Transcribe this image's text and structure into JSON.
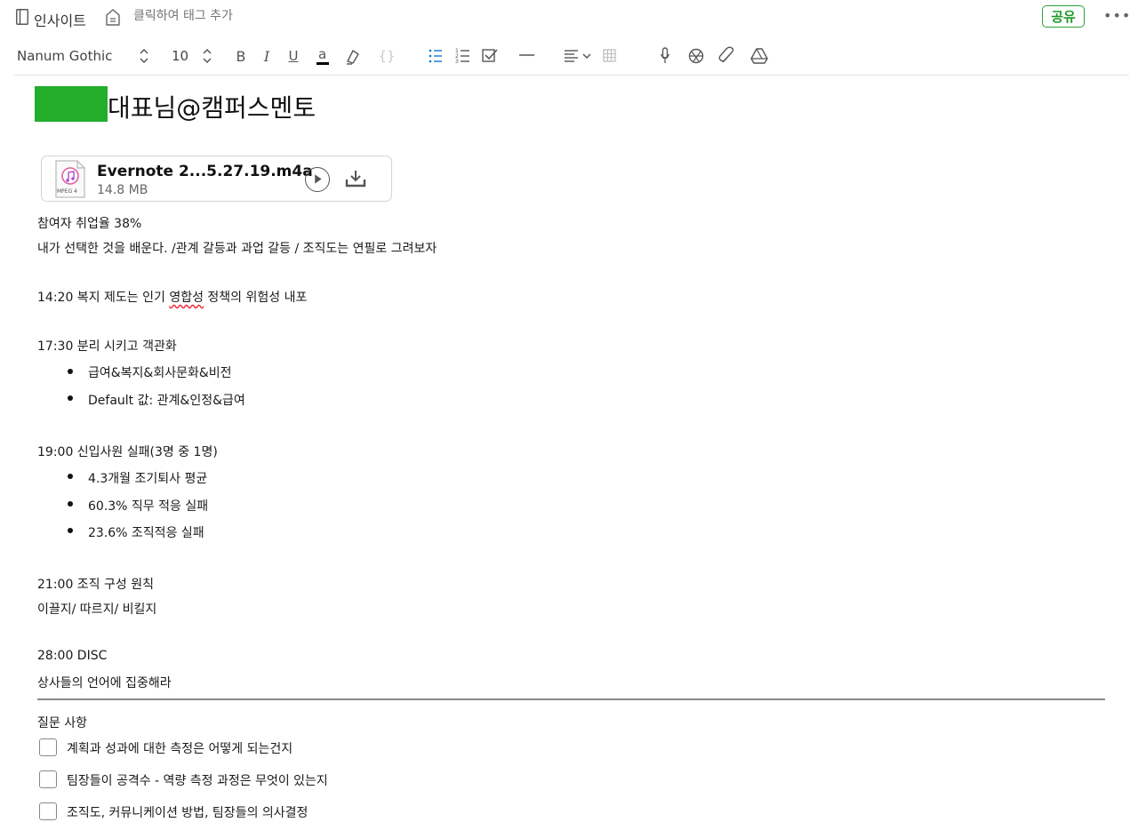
{
  "header": {
    "notebook_name": "인사이트",
    "tag_placeholder": "클릭하여 태그 추가",
    "share_label": "공유",
    "more_label": "•••"
  },
  "toolbar": {
    "font_family": "Nanum Gothic",
    "font_size": "10",
    "icons": [
      "bold-icon",
      "italic-icon",
      "underline-icon",
      "text-color-icon",
      "highlighter-icon",
      "code-block-icon",
      "bulleted-list-icon",
      "numbered-list-icon",
      "checklist-icon",
      "horizontal-rule-icon",
      "alignment-icon",
      "table-icon",
      "microphone-icon",
      "camera-icon",
      "attachment-icon",
      "drive-icon"
    ],
    "text_color": "#000000",
    "accent_color": "#2aa432"
  },
  "note": {
    "title": "대표님@캠퍼스멘토",
    "attachment": {
      "name": "Evernote 2...5.27.19.m4a",
      "size": "14.8 MB",
      "type_label": "MPEG 4"
    },
    "lines": {
      "l1": "참여자 취업율 38%",
      "l2": "내가 선택한 것을 배운다. /관계 갈등과 과업 갈등 / 조직도는 연필로 그려보자",
      "l3_pre": "14:20 복지 제도는 인기 ",
      "l3_mark": "영합성",
      "l3_post": " 정책의 위험성 내포",
      "l4": "17:30 분리 시키고 객관화",
      "b1": "급여&복지&회사문화&비전",
      "b2": "Default 값: 관계&인정&급여",
      "l5": "19:00 신입사원 실패(3명 중 1명)",
      "b3": "4.3개월 조기퇴사 평균",
      "b4": "60.3% 직무 적응 실패",
      "b5": "23.6% 조직적응 실패",
      "l6": "21:00 조직 구성 원칙",
      "l7": "이끌지/ 따르지/ 비킬지",
      "l8": "28:00 DISC",
      "l9": "상사들의 언어에 집중해라",
      "l10": "질문 사항"
    },
    "checklist": [
      {
        "text": "계획과 성과에 대한 측정은 어떻게 되는건지",
        "checked": false
      },
      {
        "text": "팀장들이 공격수 - 역량 측정 과정은 무엇이 있는지",
        "checked": false
      },
      {
        "text": "조직도, 커뮤니케이션 방법, 팀장들의 의사결정",
        "checked": false
      }
    ]
  }
}
